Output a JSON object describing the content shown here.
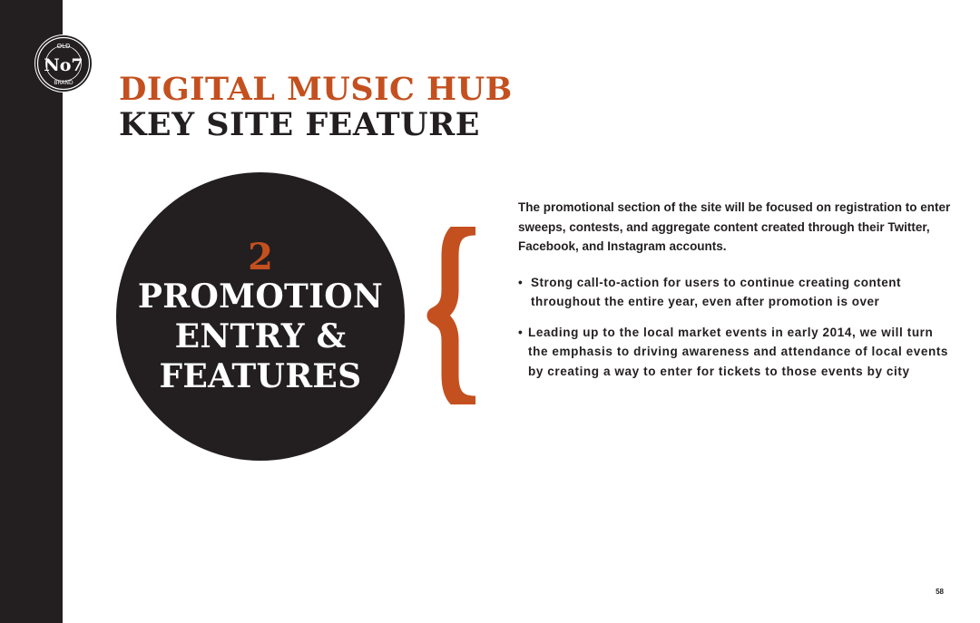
{
  "logo": {
    "top_text": "OLD",
    "number_text": "No7",
    "bottom_text": "BRAND"
  },
  "header": {
    "title_line1": "DIGITAL MUSIC HUB",
    "title_line2": "KEY SITE FEATURE"
  },
  "feature": {
    "number": "2",
    "line1": "PROMOTION",
    "line2": "ENTRY &",
    "line3": "FEATURES"
  },
  "content": {
    "intro": "The promotional section of the site will be focused on registration to enter sweeps, contests, and aggregate content created through their Twitter, Facebook, and Instagram accounts.",
    "bullet_marker": "•",
    "bullets": [
      "Strong call-to-action for users to continue creating content throughout the entire year, even after promotion is over",
      "Leading up to the local market events in early 2014, we will turn the emphasis to driving awareness and attendance of local events by creating a way to enter for tickets to those events by city"
    ]
  },
  "footer": {
    "page_number": "58"
  },
  "colors": {
    "accent": "#c4501f",
    "dark": "#231f20",
    "background": "#ffffff"
  }
}
